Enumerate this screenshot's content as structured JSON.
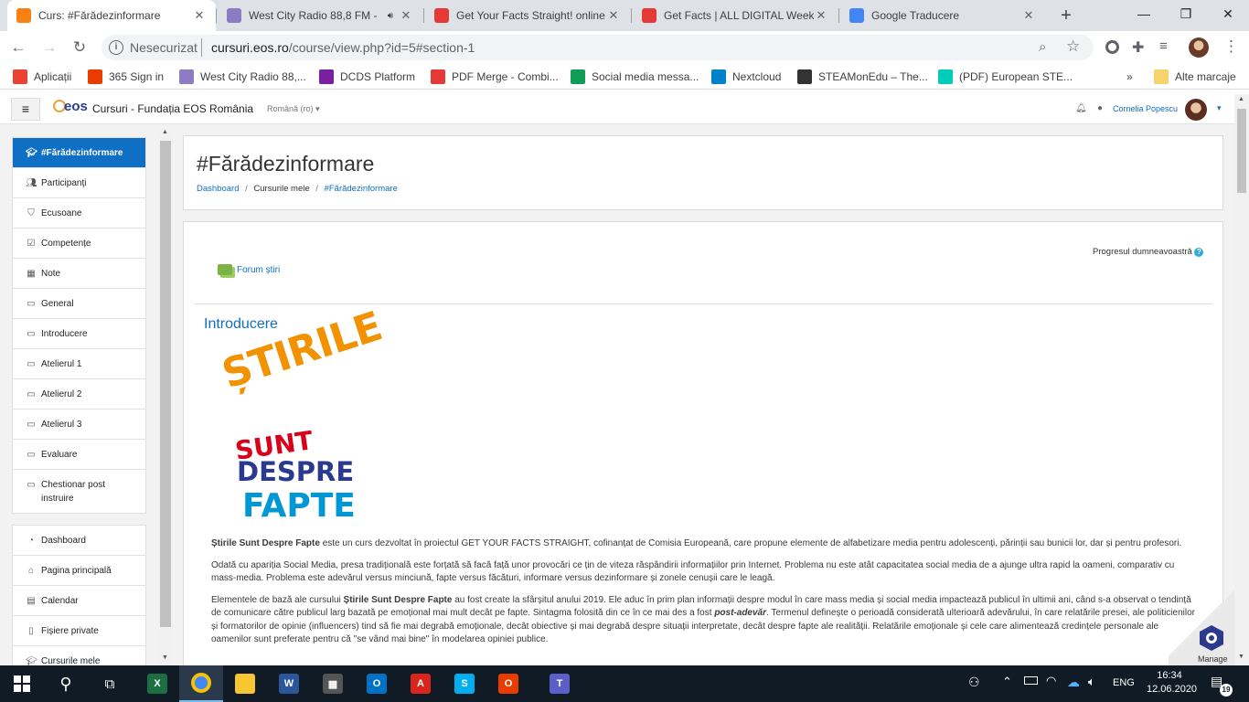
{
  "browser": {
    "tabs": [
      {
        "title": "Curs: #Fărădezinformare",
        "favicon": "moodle-icon",
        "color": "#f98012"
      },
      {
        "title": "West City Radio 88,8 FM -",
        "favicon": "radio-icon",
        "color": "#8e7cc3"
      },
      {
        "title": "Get Your Facts Straight! online",
        "favicon": "gyfs-icon",
        "color": "#e53935"
      },
      {
        "title": "Get Facts | ALL DIGITAL Week",
        "favicon": "gyfs-icon",
        "color": "#e53935"
      },
      {
        "title": "Google Traducere",
        "favicon": "google-translate-icon",
        "color": "#4285f4"
      }
    ],
    "new_tab": "+",
    "window_controls": {
      "minimize": "—",
      "maximize": "❐",
      "close": "✕"
    },
    "address": {
      "security": "Nesecurizat",
      "url_host": "cursuri.eos.ro",
      "url_path": "/course/view.php?id=5#section-1"
    },
    "bookmarks": [
      {
        "label": "Aplicații",
        "icon": "apps-grid-icon",
        "color": "#ea4335"
      },
      {
        "label": "365 Sign in",
        "icon": "office-icon",
        "color": "#eb3c00"
      },
      {
        "label": "West City Radio 88,...",
        "icon": "radio-icon",
        "color": "#8e7cc3"
      },
      {
        "label": "DCDS Platform",
        "icon": "dcds-icon",
        "color": "#7b1fa2"
      },
      {
        "label": "PDF Merge - Combi...",
        "icon": "pdf-merge-icon",
        "color": "#e53935"
      },
      {
        "label": "Social media messa...",
        "icon": "plus-doc-icon",
        "color": "#0f9d58"
      },
      {
        "label": "Nextcloud",
        "icon": "nextcloud-icon",
        "color": "#0082c9"
      },
      {
        "label": "STEAMonEdu – The...",
        "icon": "steam-icon",
        "color": "#333333"
      },
      {
        "label": "(PDF) European STE...",
        "icon": "researchgate-icon",
        "color": "#00ccbb"
      }
    ],
    "bookmarks_more": "»",
    "other_bookmarks": "Alte marcaje"
  },
  "moodle": {
    "site_name": "Cursuri - Fundația EOS România",
    "logo_text": "eos",
    "language": "Română (ro)",
    "user_name": "Cornelia Popescu",
    "drawer_course": [
      {
        "label": "#Fărădezinformare",
        "icon": "graduation-cap-icon",
        "active": true
      },
      {
        "label": "Participanți",
        "icon": "users-icon"
      },
      {
        "label": "Ecusoane",
        "icon": "shield-icon"
      },
      {
        "label": "Competențe",
        "icon": "checkbox-icon"
      },
      {
        "label": "Note",
        "icon": "table-icon"
      },
      {
        "label": "General",
        "icon": "folder-icon"
      },
      {
        "label": "Introducere",
        "icon": "folder-icon"
      },
      {
        "label": "Atelierul 1",
        "icon": "folder-icon"
      },
      {
        "label": "Atelierul 2",
        "icon": "folder-icon"
      },
      {
        "label": "Atelierul 3",
        "icon": "folder-icon"
      },
      {
        "label": "Evaluare",
        "icon": "folder-icon"
      },
      {
        "label": "Chestionar post instruire",
        "icon": "folder-icon"
      }
    ],
    "drawer_site": [
      {
        "label": "Dashboard",
        "icon": "dashboard-icon"
      },
      {
        "label": "Pagina principală",
        "icon": "home-icon"
      },
      {
        "label": "Calendar",
        "icon": "calendar-icon"
      },
      {
        "label": "Fișiere private",
        "icon": "file-icon"
      },
      {
        "label": "Cursurile mele",
        "icon": "graduation-cap-icon"
      }
    ],
    "page_title": "#Fărădezinformare",
    "breadcrumb": [
      "Dashboard",
      "Cursurile mele",
      "#Fărădezinformare"
    ],
    "progress_label": "Progresul dumneavoastră",
    "forum_label": "Forum știri",
    "section_title": "Introducere",
    "logo_lines": [
      "ȘTIRILE",
      "SUNT",
      "DESPRE",
      "FAPTE"
    ],
    "colors": {
      "accent": "#0f6fc5",
      "orange": "#f39200",
      "red": "#d9001b",
      "navy": "#2b3a8f",
      "blue": "#0098d4"
    },
    "paragraphs": {
      "p1": {
        "b": "Știrile Sunt Despre Fapte",
        "rest": " este un curs dezvoltat în proiectul GET YOUR FACTS STRAIGHT, cofinanțat de Comisia Europeană, care propune elemente de alfabetizare media pentru adolescenți, părinții sau bunicii lor, dar și pentru profesori."
      },
      "p2": "Odată cu apariția Social Media, presa tradițională este forțată să facă față unor provocări ce țin de viteza răspândirii informațiilor prin Internet. Problema nu este atât capacitatea social media de a ajunge ultra rapid la oameni, comparativ cu mass-media. Problema este adevărul versus minciună, fapte versus făcături, informare versus dezinformare și zonele cenușii care le leagă.",
      "p3": {
        "a": "Elementele de bază ale cursului ",
        "b": "Știrile Sunt Despre Fapte",
        "c": " au fost create la sfârșitul anului 2019. Ele aduc în prim plan informații despre modul în care mass media și social media impactează publicul în ultimii ani, când s-a observat o tendință de comunicare către publicul larg bazată pe emoțional mai mult decât pe fapte. Sintagma folosită din ce în ce mai des a fost ",
        "bi": "post-adevăr",
        "d": ". Termenul definește o perioadă considerată ulterioară adevărului, în care relatările presei, ale politicienilor și formatorilor de opinie (influencers) tind să fie mai degrabă emoționale, decât obiective și mai degrabă despre situații interpretate, decât despre fapte ale realității. Relatările emoționale și cele care alimentează credințele personale ale oamenilor sunt preferate pentru că \"se vând mai bine\" în modelarea opiniei publice."
      }
    },
    "manage_label": "Manage"
  },
  "taskbar": {
    "apps": [
      {
        "name": "excel-icon",
        "letter": "X",
        "color": "#1d6f42"
      },
      {
        "name": "chrome-icon",
        "letter": "",
        "color": "#db4437"
      },
      {
        "name": "file-explorer-icon",
        "letter": "",
        "color": "#f8c630"
      },
      {
        "name": "word-icon",
        "letter": "W",
        "color": "#2b579a"
      },
      {
        "name": "calculator-icon",
        "letter": "▦",
        "color": "#555555"
      },
      {
        "name": "outlook-icon",
        "letter": "O",
        "color": "#0072c6"
      },
      {
        "name": "acrobat-icon",
        "letter": "A",
        "color": "#d9261c"
      },
      {
        "name": "skype-icon",
        "letter": "S",
        "color": "#00aff0"
      },
      {
        "name": "office-icon",
        "letter": "O",
        "color": "#eb3c00"
      },
      {
        "name": "teams-icon",
        "letter": "T",
        "color": "#5b5fc7"
      }
    ],
    "language": "ENG",
    "time": "16:34",
    "date": "12.06.2020",
    "notifications": "19"
  }
}
